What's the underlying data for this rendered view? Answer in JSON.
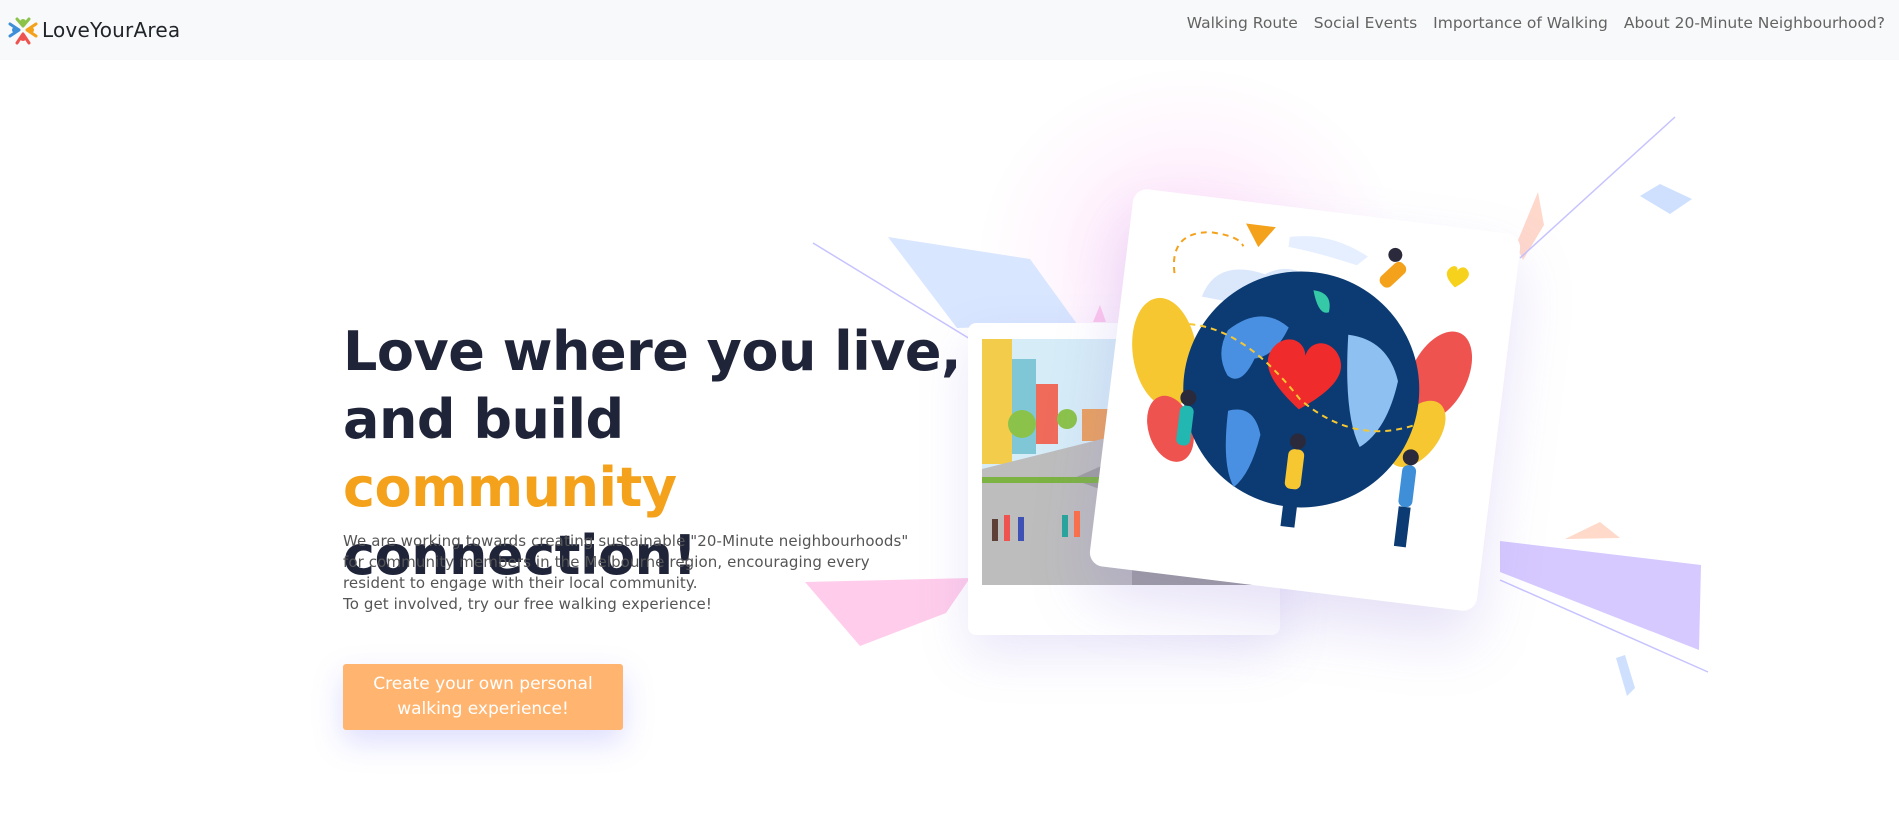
{
  "navbar": {
    "brand": "LoveYourArea",
    "links": [
      "Walking Route",
      "Social Events",
      "Importance of Walking",
      "About 20-Minute Neighbourhood?"
    ]
  },
  "hero": {
    "title_part1": "Love where you live, and build ",
    "title_accent": "community",
    "title_part2": " connection!",
    "description_line1": "We are working towards creating sustainable \"20-Minute neighbourhoods\" for community members in the Melbourne region, encouraging every resident to engage with their local community.",
    "description_line2": "To get involved, try our free walking experience!",
    "cta_label": "Create your own personal walking experience!"
  },
  "colors": {
    "accent": "#f4a11b",
    "cta": "#ffb570",
    "title": "#1f2439",
    "navbar_bg": "#f8f9fa"
  },
  "icons": {
    "brand_logo": "people-circle-logo-icon",
    "street_image": "street-scene-illustration",
    "globe_image": "globe-community-illustration"
  }
}
